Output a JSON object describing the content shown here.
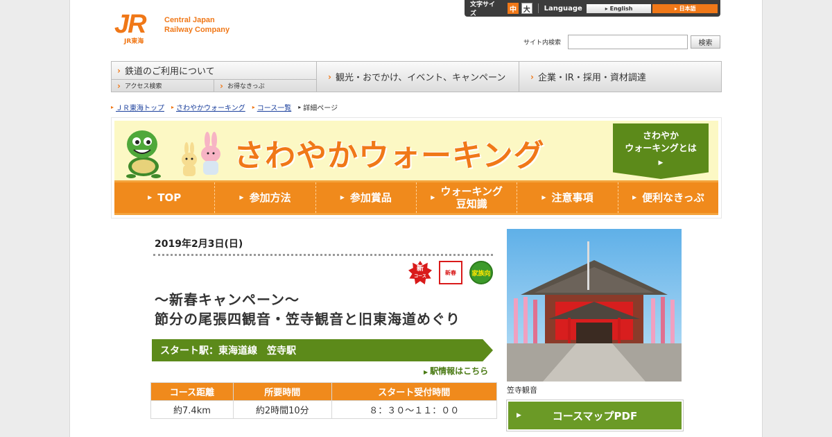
{
  "header": {
    "logo_mark": "JR",
    "logo_sub": "JR東海",
    "company_line1": "Central Japan",
    "company_line2": "Railway Company",
    "font_size_label": "文字サイズ",
    "font_mid": "中",
    "font_big": "大",
    "language_label": "Language",
    "lang_en": "English",
    "lang_ja": "日本語",
    "search_label": "サイト内検索",
    "search_value": "",
    "search_button": "検索"
  },
  "gnav": {
    "railway": "鉄道のご利用について",
    "access": "アクセス検索",
    "tickets": "お得なきっぷ",
    "sightseeing": "観光・おでかけ、イベント、キャンペーン",
    "corporate": "企業・IR・採用・資材調達"
  },
  "breadcrumb": [
    {
      "label": "ＪＲ東海トップ"
    },
    {
      "label": "さわやかウォーキング"
    },
    {
      "label": "コース一覧"
    },
    {
      "label": "詳細ページ"
    }
  ],
  "banner": {
    "title": "さわやかウォーキング",
    "whatis_line1": "さわやか",
    "whatis_line2": "ウォーキングとは",
    "nav": [
      "TOP",
      "参加方法",
      "参加賞品",
      "ウォーキング",
      "豆知識",
      "注意事項",
      "便利なきっぷ"
    ]
  },
  "event": {
    "date": "2019年2月3日(日)",
    "badges": {
      "new_top": "新",
      "new_bottom": "コース",
      "spring": "新春",
      "family": "家族向"
    },
    "title_line1": "～新春キャンペーン～",
    "title_line2": "節分の尾張四観音・笠寺観音と旧東海道めぐり",
    "start_station": "スタート駅：東海道線　笠寺駅",
    "station_link": "駅情報はこちら",
    "table_headers": [
      "コース距離",
      "所要時間",
      "スタート受付時間"
    ],
    "table_values": [
      "約7.4km",
      "約2時間10分",
      "８：３０～１１：００"
    ],
    "photo_caption": "笠寺観音",
    "pdf_button": "コースマップPDF"
  },
  "colors": {
    "accent": "#f07818",
    "green": "#5c8a1a",
    "link": "#1a3f9c"
  }
}
